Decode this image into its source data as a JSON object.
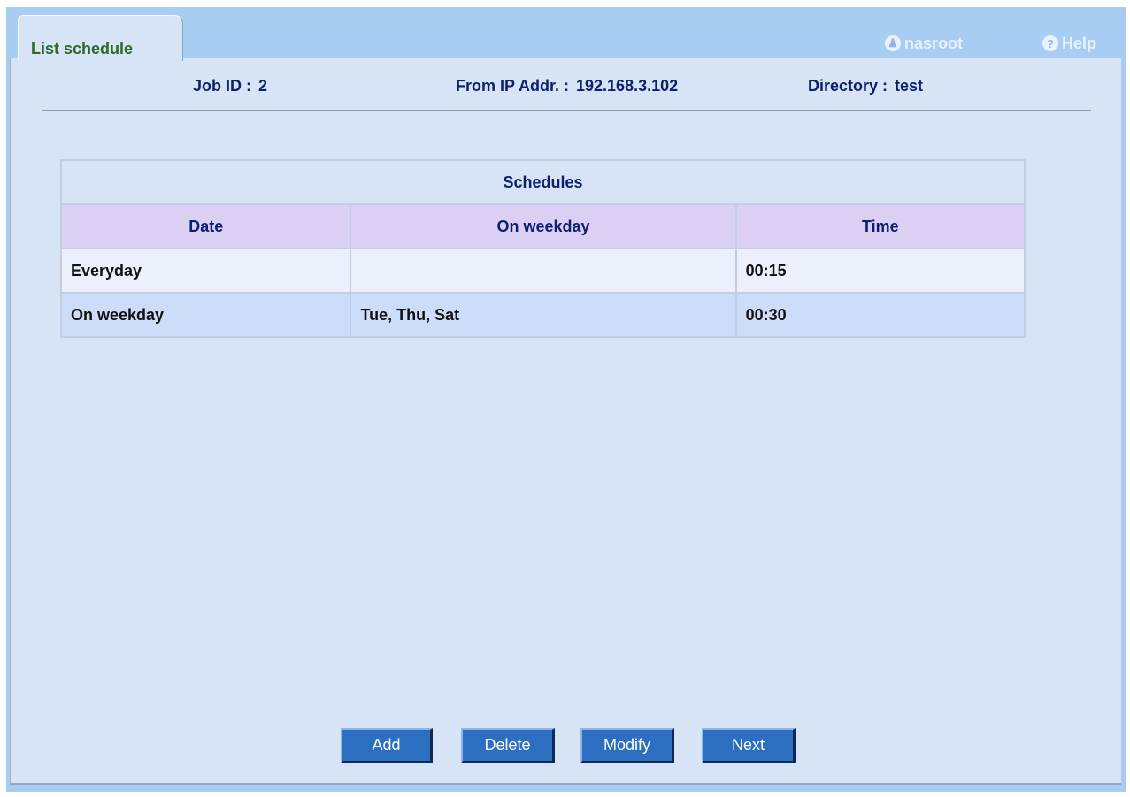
{
  "tab": {
    "label": "List schedule"
  },
  "header_links": {
    "user": {
      "label": "nasroot",
      "icon": "user-icon"
    },
    "help": {
      "label": "Help",
      "icon": "help-icon"
    }
  },
  "job_info": {
    "job_id_label": "Job ID :",
    "job_id_value": "2",
    "from_ip_label": "From IP Addr. :",
    "from_ip_value": "192.168.3.102",
    "directory_label": "Directory :",
    "directory_value": "test"
  },
  "schedules": {
    "title": "Schedules",
    "columns": [
      "Date",
      "On weekday",
      "Time"
    ],
    "rows": [
      [
        "Everyday",
        "",
        "00:15"
      ],
      [
        "On weekday",
        "Tue, Thu, Sat",
        "00:30"
      ]
    ]
  },
  "buttons": {
    "add": "Add",
    "delete": "Delete",
    "modify": "Modify",
    "next": "Next"
  },
  "colors": {
    "outer_frame": "#a8cdf3",
    "panel": "#d7e4f5",
    "header_row": "#dccff4",
    "row_light": "#ebf0fb",
    "row_blue": "#cddcf8",
    "button": "#2c6fc0",
    "tab_label": "#2c6a2c",
    "info_text": "#0f1f70"
  }
}
